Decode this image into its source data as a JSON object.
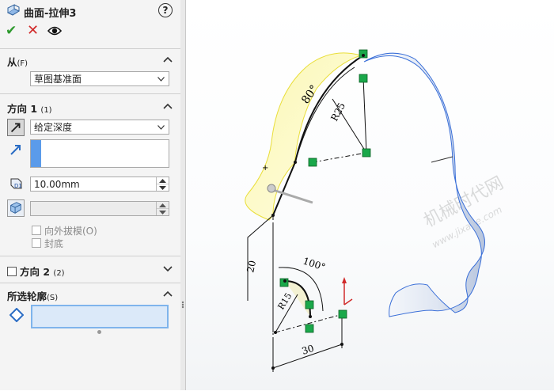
{
  "feature": {
    "title": "曲面-拉伸3",
    "help_label": "?"
  },
  "actions": {
    "ok": "✔",
    "cancel": "✕"
  },
  "from": {
    "heading": "从",
    "shortcut": "(F)",
    "selected": "草图基准面"
  },
  "direction1": {
    "heading": "方向 1",
    "shortcut": "(1)",
    "end_condition": "给定深度",
    "depth_value": "10.00mm",
    "draft_outward_label": "向外拔模(O)",
    "cap_end_label": "封底"
  },
  "direction2": {
    "heading": "方向 2",
    "shortcut": "(2)"
  },
  "contours": {
    "heading": "所选轮廓",
    "shortcut": "(S)"
  },
  "viewport": {
    "dimensions": {
      "angle_top": "80°",
      "radius_top": "R25",
      "dim_20": "20",
      "angle_bottom": "100°",
      "radius_bottom": "R15",
      "dim_30": "30"
    },
    "watermark_main": "机械时代网",
    "watermark_url": "www.jixage.com"
  },
  "colors": {
    "accent": "#5b9bea",
    "ok": "#2e9a2e",
    "cancel": "#d12b2b",
    "constraint": "#1aa84a",
    "yellow_preview": "#f6f29a"
  }
}
